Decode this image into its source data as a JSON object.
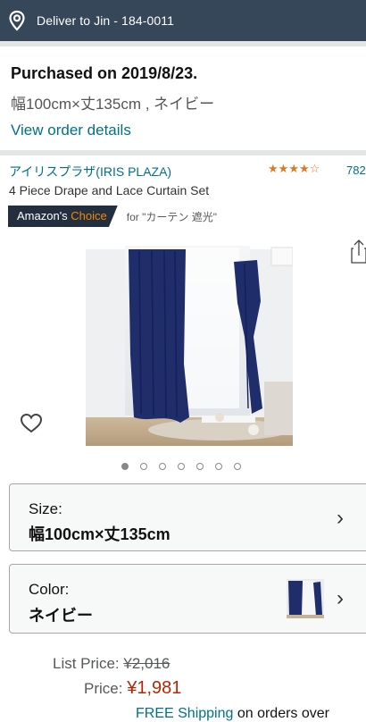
{
  "header": {
    "deliver_text": "Deliver to Jin -  184-0011"
  },
  "purchase": {
    "title": "Purchased on 2019/8/23.",
    "variant": "幅100cm×丈135cm , ネイビー",
    "view_link": "View order details"
  },
  "product": {
    "brand": "アイリスプラザ(IRIS PLAZA)",
    "rating_stars": 4,
    "review_count": "782",
    "name": "4 Piece Drape and Lace Curtain Set",
    "choice_prefix": "Amazon's ",
    "choice_word": "Choice",
    "choice_for": "for \"カーテン 遮光\"",
    "image_count": 7,
    "active_image": 1
  },
  "size": {
    "label": "Size:",
    "value": "幅100cm×丈135cm"
  },
  "color": {
    "label": "Color:",
    "value": "ネイビー"
  },
  "pricing": {
    "list_label": "List Price:",
    "list_value": "¥2,016",
    "price_label": "Price:",
    "price_value": "¥1,981",
    "shipping_link": "FREE Shipping",
    "shipping_rest": " on orders over"
  },
  "colors": {
    "topbar": "#37475a",
    "link": "#007185",
    "price": "#b12704",
    "star": "#de7921",
    "curtain": "#1f2d6b"
  }
}
